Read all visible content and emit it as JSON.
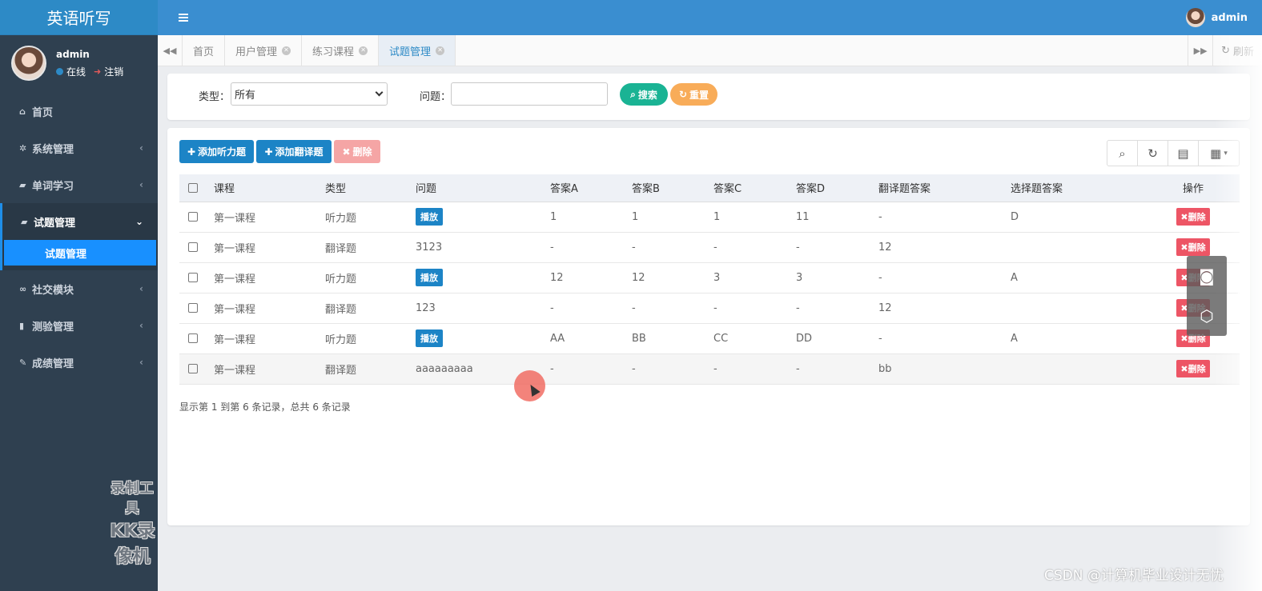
{
  "app": {
    "title": "英语听写"
  },
  "sidebar": {
    "user": {
      "name": "admin",
      "status": "在线",
      "logout": "注销"
    },
    "items": [
      {
        "label": "首页",
        "icon": "home-icon",
        "has_children": false,
        "active": false
      },
      {
        "label": "系统管理",
        "icon": "gear-icon",
        "has_children": true,
        "active": false
      },
      {
        "label": "单词学习",
        "icon": "book-icon",
        "has_children": true,
        "active": false
      },
      {
        "label": "试题管理",
        "icon": "book-icon",
        "has_children": true,
        "active": true,
        "expanded": true
      },
      {
        "label": "社交模块",
        "icon": "binoculars-icon",
        "has_children": true,
        "active": false
      },
      {
        "label": "测验管理",
        "icon": "bookmark-icon",
        "has_children": true,
        "active": false
      },
      {
        "label": "成绩管理",
        "icon": "edit-icon",
        "has_children": true,
        "active": false
      }
    ],
    "submenu": [
      {
        "label": "试题管理",
        "active": true
      }
    ]
  },
  "topbar": {
    "user_name": "admin"
  },
  "tabs": {
    "items": [
      {
        "label": "首页",
        "closable": false,
        "active": false
      },
      {
        "label": "用户管理",
        "closable": true,
        "active": false
      },
      {
        "label": "练习课程",
        "closable": true,
        "active": false
      },
      {
        "label": "试题管理",
        "closable": true,
        "active": true
      }
    ],
    "refresh_label": "刷新"
  },
  "search": {
    "type_label": "类型：",
    "type_value": "所有",
    "question_label": "问题：",
    "question_value": "",
    "search_button": "搜索",
    "reset_button": "重置"
  },
  "toolbar": {
    "add_listen": "添加听力题",
    "add_translate": "添加翻译题",
    "delete": "删除"
  },
  "table": {
    "columns": [
      "课程",
      "类型",
      "问题",
      "答案A",
      "答案B",
      "答案C",
      "答案D",
      "翻译题答案",
      "选择题答案",
      "操作"
    ],
    "play_label": "播放",
    "delete_label": "删除",
    "rows": [
      {
        "course": "第一课程",
        "type": "听力题",
        "question": "播放",
        "is_play": true,
        "a": "1",
        "b": "1",
        "c": "1",
        "d": "11",
        "trans": "-",
        "choice": "D"
      },
      {
        "course": "第一课程",
        "type": "翻译题",
        "question": "3123",
        "is_play": false,
        "a": "-",
        "b": "-",
        "c": "-",
        "d": "-",
        "trans": "12",
        "choice": ""
      },
      {
        "course": "第一课程",
        "type": "听力题",
        "question": "播放",
        "is_play": true,
        "a": "12",
        "b": "12",
        "c": "3",
        "d": "3",
        "trans": "-",
        "choice": "A"
      },
      {
        "course": "第一课程",
        "type": "翻译题",
        "question": "123",
        "is_play": false,
        "a": "-",
        "b": "-",
        "c": "-",
        "d": "-",
        "trans": "12",
        "choice": ""
      },
      {
        "course": "第一课程",
        "type": "听力题",
        "question": "播放",
        "is_play": true,
        "a": "AA",
        "b": "BB",
        "c": "CC",
        "d": "DD",
        "trans": "-",
        "choice": "A"
      },
      {
        "course": "第一课程",
        "type": "翻译题",
        "question": "aaaaaaaaa",
        "is_play": false,
        "a": "-",
        "b": "-",
        "c": "-",
        "d": "-",
        "trans": "bb",
        "choice": ""
      }
    ]
  },
  "pagination": {
    "summary": "显示第 1 到第 6 条记录，总共 6 条记录"
  },
  "overlay": {
    "watermark_line1": "录制工具",
    "watermark_line2": "KK录像机",
    "csdn": "CSDN @计算机毕业设计无忧"
  },
  "colors": {
    "brand": "#2d8ac6",
    "sidebar_bg": "#2f4050",
    "primary": "#1c84c6",
    "success": "#1ab394",
    "warning": "#f8ac59",
    "danger": "#ed5565",
    "submenu_active": "#1890ff"
  }
}
